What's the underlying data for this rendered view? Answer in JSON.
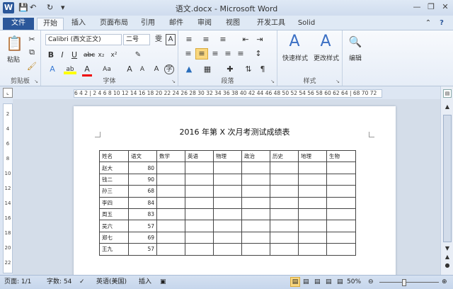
{
  "window": {
    "title": "语文.docx - Microsoft Word",
    "app_icon": "W"
  },
  "qat": {
    "undo": "↶",
    "redo": "↻",
    "customize": "▾"
  },
  "tabs": [
    {
      "label": "文件"
    },
    {
      "label": "开始"
    },
    {
      "label": "插入"
    },
    {
      "label": "页面布局"
    },
    {
      "label": "引用"
    },
    {
      "label": "邮件"
    },
    {
      "label": "审阅"
    },
    {
      "label": "视图"
    },
    {
      "label": "开发工具"
    },
    {
      "label": "Solid"
    }
  ],
  "ribbon": {
    "clipboard": {
      "label": "剪贴板",
      "paste": "粘贴"
    },
    "font": {
      "label": "字体",
      "name": "Calibri (西文正文)",
      "size": "二号"
    },
    "paragraph": {
      "label": "段落"
    },
    "styles": {
      "label": "样式",
      "quick": "快速样式",
      "change": "更改样式"
    },
    "editing": {
      "label": "编辑"
    }
  },
  "ruler": {
    "text": "6 4 2 | 2 4 6 8 10 12 14 16 18 20 22 24 26 28 30 32 34 36 38 40 42 44 46 48 50 52 54 56 58 60 62 64 | 68 70 72"
  },
  "vruler": [
    "2",
    "4",
    "6",
    "8",
    "10",
    "12",
    "14",
    "16",
    "18",
    "20",
    "22"
  ],
  "document": {
    "title": "2016 年第 X 次月考测试成绩表",
    "headers": [
      "姓名",
      "语文",
      "数学",
      "英语",
      "物理",
      "政治",
      "历史",
      "地理",
      "生物"
    ],
    "rows": [
      {
        "name": "赵大",
        "chinese": "80"
      },
      {
        "name": "钱二",
        "chinese": "90"
      },
      {
        "name": "孙三",
        "chinese": "68"
      },
      {
        "name": "李四",
        "chinese": "84"
      },
      {
        "name": "周五",
        "chinese": "83"
      },
      {
        "name": "吴六",
        "chinese": "57"
      },
      {
        "name": "郑七",
        "chinese": "69"
      },
      {
        "name": "王九",
        "chinese": "57"
      }
    ]
  },
  "status": {
    "page": "页面: 1/1",
    "words": "字数: 54",
    "language": "英语(美国)",
    "mode": "插入",
    "zoom": "50%"
  },
  "colors": {
    "file_tab": "#2b579a",
    "ribbon_bg": "#e6edf7",
    "highlight": "#f9d77e"
  }
}
